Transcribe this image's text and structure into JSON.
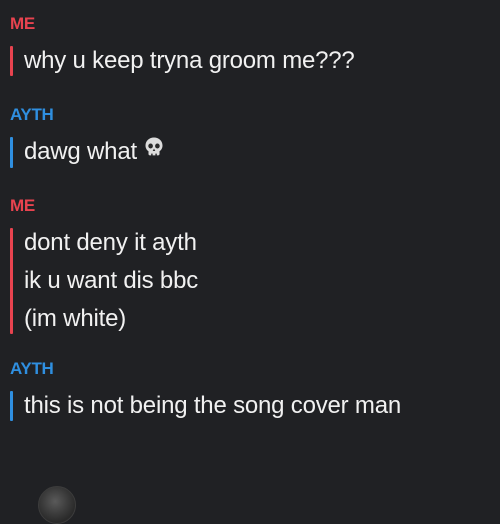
{
  "messages": [
    {
      "sender": "ME",
      "lines": [
        "why u keep tryna groom me???"
      ]
    },
    {
      "sender": "AYTH",
      "lines": [
        "dawg what"
      ],
      "emoji": "skull-icon"
    },
    {
      "sender": "ME",
      "lines": [
        "dont deny it ayth",
        "ik u want dis bbc",
        "(im white)"
      ]
    },
    {
      "sender": "AYTH",
      "lines": [
        "this is not being the song cover man"
      ]
    }
  ],
  "colors": {
    "background": "#202124",
    "me": "#e8434f",
    "ayth": "#2f8fe0",
    "text": "#f1f1f1"
  }
}
